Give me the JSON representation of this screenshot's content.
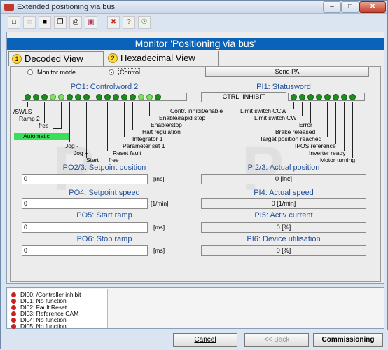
{
  "window": {
    "title": "Extended positioning via bus"
  },
  "monitor": {
    "title": "Monitor 'Positioning via bus'"
  },
  "tabs": [
    {
      "num": "1",
      "label": "Decoded View"
    },
    {
      "num": "2",
      "label": "Hexadecimal View"
    }
  ],
  "mode": {
    "monitor_label": "Monitor mode",
    "control_label": "Control",
    "selected": "Control",
    "send_pa": "Send PA"
  },
  "po1": {
    "title": "PO1: Controlword 2",
    "labels": {
      "swls": "/SWLS",
      "ramp2": "Ramp 2",
      "free1": "free",
      "automatic": "Automatic",
      "jog_minus": "Jog -",
      "jog_plus": "Jog +",
      "start": "Start",
      "free2": "free",
      "reset_fault": "Reset fault",
      "param_set": "Parameter set 1",
      "integrator": "Integrator 1",
      "halt_reg": "Halt regulation",
      "enable_stop": "Enable/stop",
      "enable_rapid": "Enable/rapid stop",
      "contr_inhibit": "Contr. inhibit/enable"
    }
  },
  "pi1": {
    "title": "PI1: Statusword",
    "state": "CTRL. INHIBIT",
    "labels": {
      "lim_ccw": "Limit switch CCW",
      "lim_cw": "Limit switch CW",
      "error": "Error",
      "brake": "Brake released",
      "target": "Target position reached",
      "ipos": "IPOS reference",
      "inverter": "Inverter ready",
      "motor": "Motor turning"
    }
  },
  "po23": {
    "title": "PO2/3: Setpoint position",
    "value": "0",
    "unit": "[inc]"
  },
  "pi23": {
    "title": "PI2/3: Actual position",
    "value": "0 [inc]"
  },
  "po4": {
    "title": "PO4: Setpoint speed",
    "value": "0",
    "unit": "[1/min]"
  },
  "pi4": {
    "title": "PI4: Actual speed",
    "value": "0 [1/min]"
  },
  "po5": {
    "title": "PO5: Start ramp",
    "value": "0",
    "unit": "[ms]"
  },
  "pi5": {
    "title": "PI5: Activ current",
    "value": "0 [%]"
  },
  "po6": {
    "title": "PO6: Stop ramp",
    "value": "0",
    "unit": "[ms]"
  },
  "pi6": {
    "title": "PI6: Device utilisation",
    "value": "0 [%]"
  },
  "inputs": [
    "DI00: /Controller inhibit",
    "DI01: No function",
    "DI02: Fault Reset",
    "DI03: Reference CAM",
    "DI04: No function",
    "DI05: No function"
  ],
  "footer": {
    "cancel": "Cancel",
    "back": "<< Back",
    "commissioning": "Commissioning"
  },
  "colors": {
    "header": "#0a63b8",
    "led_dark": "#1a8f1a",
    "led_light": "#7fe05c",
    "automatic": "#38e05a",
    "di_led": "#cc2020"
  }
}
